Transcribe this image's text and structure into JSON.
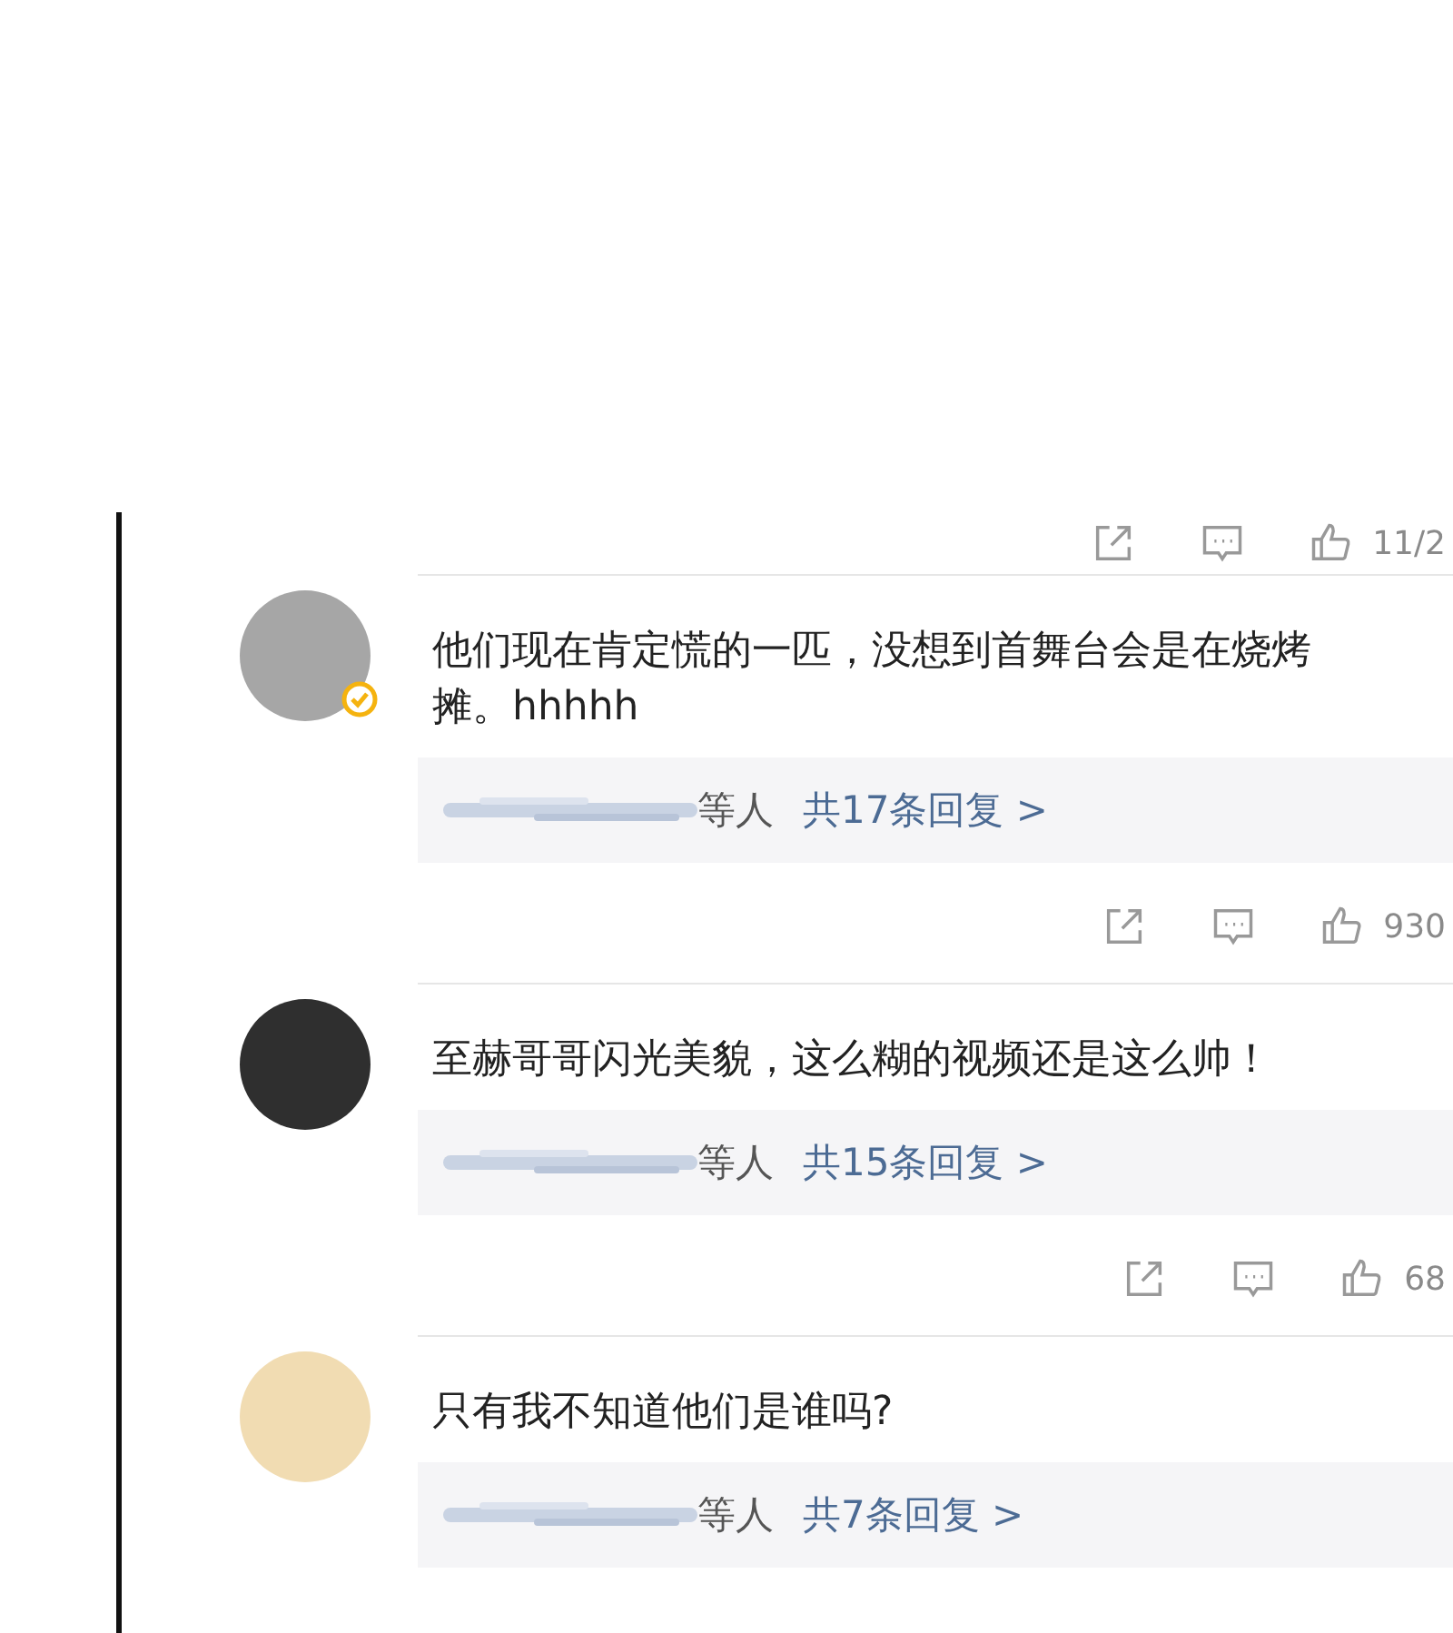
{
  "top_actions": {
    "like_count": "11/2"
  },
  "comments": [
    {
      "color": "#a6a6a6",
      "verified": true,
      "text": "他们现在肯定慌的一匹，没想到首舞台会是在烧烤摊。hhhhh",
      "reply_people": "等人",
      "reply_link": "共17条回复 >",
      "actions": {
        "like_count": "930"
      }
    },
    {
      "color": "#2f2f2f",
      "verified": false,
      "text": "至赫哥哥闪光美貌，这么糊的视频还是这么帅！",
      "reply_people": "等人",
      "reply_link": "共15条回复 >",
      "actions": {
        "like_count": "68"
      }
    },
    {
      "color": "#f1dcb2",
      "verified": false,
      "text": "只有我不知道他们是谁吗?",
      "reply_people": "等人",
      "reply_link": "共7条回复 >"
    }
  ]
}
